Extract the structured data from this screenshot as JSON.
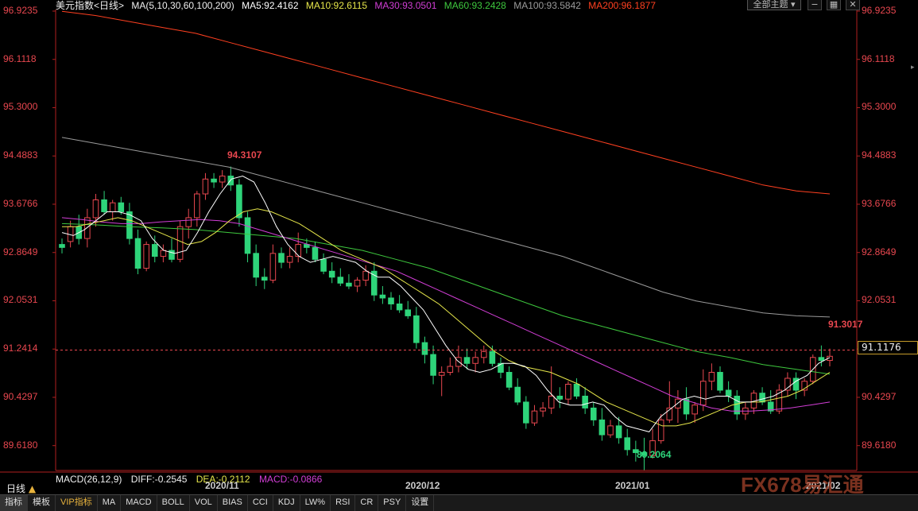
{
  "header": {
    "symbol": "美元指数<日线>",
    "ma_params": "MA(5,10,30,60,100,200)",
    "ma5": "MA5:92.4162",
    "ma10": "MA10:92.6115",
    "ma30": "MA30:93.0501",
    "ma60": "MA60:93.2428",
    "ma100": "MA100:93.5842",
    "ma200": "MA200:96.1877",
    "theme_button": "全部主题"
  },
  "colors": {
    "up": "#e8474f",
    "down": "#2ed47a",
    "ma5": "#ffffff",
    "ma10": "#e6e64a",
    "ma30": "#d23ed6",
    "ma60": "#3ec83e",
    "ma100": "#9a9a9a",
    "ma200": "#ff4020"
  },
  "annotations": {
    "high": "94.3107",
    "low": "89.2064",
    "last_high": "91.3017",
    "current_price": "91.1176"
  },
  "macd": {
    "params": "MACD(26,12,9)",
    "diff": "DIFF:-0.2545",
    "dea": "DEA:-0.2112",
    "macd": "MACD:-0.0866"
  },
  "period_tag": "日线",
  "date_labels": [
    "2020/11",
    "2020/12",
    "2021/01",
    "2021/02"
  ],
  "bottom_tabs": [
    "指标",
    "模板",
    "VIP指标",
    "MA",
    "MACD",
    "BOLL",
    "VOL",
    "BIAS",
    "CCI",
    "KDJ",
    "LW%",
    "RSI",
    "CR",
    "PSY",
    "设置"
  ],
  "watermark": "FX678易汇通",
  "chart_data": {
    "type": "candlestick",
    "y_ticks": [
      "96.9235",
      "96.1118",
      "95.3000",
      "94.4883",
      "93.6766",
      "92.8649",
      "92.0531",
      "91.2414",
      "90.4297",
      "89.6180"
    ],
    "ylim": [
      89.2,
      96.95
    ],
    "candles": [
      [
        93.0,
        93.1,
        92.85,
        92.95
      ],
      [
        93.05,
        93.4,
        92.95,
        93.3
      ],
      [
        93.3,
        93.5,
        93.0,
        93.1
      ],
      [
        93.1,
        93.6,
        92.95,
        93.45
      ],
      [
        93.45,
        93.85,
        93.3,
        93.75
      ],
      [
        93.75,
        93.9,
        93.5,
        93.55
      ],
      [
        93.55,
        93.75,
        93.4,
        93.7
      ],
      [
        93.7,
        93.8,
        93.5,
        93.55
      ],
      [
        93.55,
        93.7,
        93.0,
        93.1
      ],
      [
        93.1,
        93.25,
        92.5,
        92.6
      ],
      [
        92.6,
        93.05,
        92.55,
        93.0
      ],
      [
        93.0,
        93.15,
        92.7,
        92.8
      ],
      [
        92.8,
        93.0,
        92.7,
        92.9
      ],
      [
        92.9,
        93.1,
        92.7,
        92.75
      ],
      [
        92.75,
        93.4,
        92.7,
        93.3
      ],
      [
        93.3,
        93.6,
        93.1,
        93.45
      ],
      [
        93.45,
        93.9,
        93.3,
        93.85
      ],
      [
        93.85,
        94.2,
        93.75,
        94.1
      ],
      [
        94.1,
        94.2,
        93.95,
        94.05
      ],
      [
        94.05,
        94.25,
        93.95,
        94.15
      ],
      [
        94.15,
        94.3107,
        93.9,
        94.0
      ],
      [
        94.0,
        94.1,
        93.3,
        93.45
      ],
      [
        93.45,
        93.55,
        92.7,
        92.85
      ],
      [
        92.85,
        93.0,
        92.3,
        92.45
      ],
      [
        92.45,
        92.6,
        92.25,
        92.4
      ],
      [
        92.4,
        93.0,
        92.35,
        92.85
      ],
      [
        92.85,
        92.95,
        92.6,
        92.7
      ],
      [
        92.7,
        92.95,
        92.6,
        92.8
      ],
      [
        92.8,
        93.2,
        92.7,
        93.0
      ],
      [
        93.0,
        93.1,
        92.85,
        92.95
      ],
      [
        92.95,
        93.05,
        92.7,
        92.75
      ],
      [
        92.75,
        92.85,
        92.5,
        92.55
      ],
      [
        92.55,
        92.7,
        92.35,
        92.45
      ],
      [
        92.45,
        92.6,
        92.3,
        92.35
      ],
      [
        92.35,
        92.5,
        92.25,
        92.3
      ],
      [
        92.3,
        92.45,
        92.2,
        92.4
      ],
      [
        92.4,
        92.65,
        92.3,
        92.55
      ],
      [
        92.55,
        92.7,
        92.05,
        92.15
      ],
      [
        92.15,
        92.3,
        92.0,
        92.1
      ],
      [
        92.1,
        92.2,
        91.9,
        92.0
      ],
      [
        92.0,
        92.15,
        91.85,
        91.9
      ],
      [
        91.9,
        92.05,
        91.75,
        91.8
      ],
      [
        91.8,
        91.95,
        91.25,
        91.35
      ],
      [
        91.35,
        91.45,
        91.0,
        91.15
      ],
      [
        91.15,
        91.3,
        90.65,
        90.8
      ],
      [
        90.8,
        90.95,
        90.45,
        90.85
      ],
      [
        90.85,
        91.1,
        90.8,
        90.95
      ],
      [
        90.95,
        91.3,
        90.85,
        91.1
      ],
      [
        91.1,
        91.25,
        90.9,
        91.0
      ],
      [
        91.0,
        91.2,
        90.85,
        91.1
      ],
      [
        91.1,
        91.3,
        91.0,
        91.2
      ],
      [
        91.2,
        91.3,
        90.95,
        91.0
      ],
      [
        91.0,
        91.1,
        90.75,
        90.85
      ],
      [
        90.85,
        90.95,
        90.55,
        90.6
      ],
      [
        90.6,
        90.75,
        90.3,
        90.35
      ],
      [
        90.35,
        90.45,
        89.9,
        90.0
      ],
      [
        90.0,
        90.3,
        89.95,
        90.2
      ],
      [
        90.2,
        90.35,
        90.1,
        90.25
      ],
      [
        90.25,
        90.95,
        90.15,
        90.45
      ],
      [
        90.45,
        90.6,
        90.25,
        90.4
      ],
      [
        90.4,
        90.7,
        90.3,
        90.65
      ],
      [
        90.65,
        90.75,
        90.4,
        90.45
      ],
      [
        90.45,
        90.6,
        90.15,
        90.25
      ],
      [
        90.25,
        90.35,
        89.95,
        90.05
      ],
      [
        90.05,
        90.25,
        89.7,
        89.8
      ],
      [
        89.8,
        90.05,
        89.75,
        89.95
      ],
      [
        89.95,
        90.1,
        89.65,
        89.75
      ],
      [
        89.75,
        89.9,
        89.45,
        89.55
      ],
      [
        89.55,
        89.7,
        89.35,
        89.5
      ],
      [
        89.5,
        89.75,
        89.2064,
        89.45
      ],
      [
        89.45,
        89.9,
        89.4,
        89.7
      ],
      [
        89.7,
        90.15,
        89.65,
        90.05
      ],
      [
        90.05,
        90.7,
        90.0,
        90.25
      ],
      [
        90.25,
        90.55,
        90.0,
        90.4
      ],
      [
        90.4,
        90.6,
        90.05,
        90.15
      ],
      [
        90.15,
        90.35,
        90.0,
        90.3
      ],
      [
        90.3,
        90.9,
        90.2,
        90.7
      ],
      [
        90.7,
        91.0,
        90.55,
        90.85
      ],
      [
        90.85,
        90.95,
        90.5,
        90.55
      ],
      [
        90.55,
        90.7,
        90.35,
        90.45
      ],
      [
        90.45,
        90.55,
        90.05,
        90.15
      ],
      [
        90.15,
        90.35,
        90.05,
        90.25
      ],
      [
        90.25,
        90.55,
        90.15,
        90.5
      ],
      [
        90.5,
        90.6,
        90.3,
        90.35
      ],
      [
        90.35,
        90.55,
        90.15,
        90.2
      ],
      [
        90.2,
        90.65,
        90.15,
        90.55
      ],
      [
        90.55,
        90.85,
        90.45,
        90.75
      ],
      [
        90.75,
        90.85,
        90.4,
        90.55
      ],
      [
        90.55,
        90.75,
        90.45,
        90.7
      ],
      [
        90.7,
        91.15,
        90.65,
        91.1
      ],
      [
        91.1,
        91.3017,
        90.95,
        91.05
      ],
      [
        91.05,
        91.25,
        90.95,
        91.12
      ]
    ],
    "ma5": [
      93.2,
      93.15,
      93.25,
      93.4,
      93.55,
      93.55,
      93.5,
      93.4,
      93.1,
      92.9,
      92.85,
      92.9,
      93.2,
      93.55,
      93.85,
      94.1,
      94.15,
      94.05,
      93.7,
      93.3,
      93.0,
      92.8,
      92.7,
      92.75,
      92.8,
      92.75,
      92.7,
      92.55,
      92.45,
      92.45,
      92.3,
      92.1,
      91.9,
      91.6,
      91.3,
      91.05,
      90.9,
      90.85,
      90.9,
      91.0,
      91.0,
      90.95,
      90.8,
      90.55,
      90.35,
      90.3,
      90.3,
      90.35,
      90.3,
      90.1,
      89.95,
      89.9,
      89.85,
      90.1,
      90.25,
      90.4,
      90.45,
      90.4,
      90.45,
      90.45,
      90.35,
      90.35,
      90.4,
      90.45,
      90.55,
      90.7,
      90.8,
      91.0,
      91.1
    ],
    "ma10": [
      93.3,
      93.3,
      93.35,
      93.4,
      93.45,
      93.4,
      93.3,
      93.2,
      93.1,
      93.0,
      93.05,
      93.2,
      93.4,
      93.55,
      93.6,
      93.55,
      93.45,
      93.35,
      93.2,
      93.05,
      92.9,
      92.8,
      92.7,
      92.6,
      92.45,
      92.3,
      92.15,
      92.0,
      91.8,
      91.6,
      91.4,
      91.2,
      91.05,
      90.95,
      90.9,
      90.85,
      90.75,
      90.65,
      90.5,
      90.35,
      90.25,
      90.15,
      90.05,
      89.95,
      89.95,
      90.0,
      90.1,
      90.2,
      90.3,
      90.35,
      90.35,
      90.4,
      90.45,
      90.55,
      90.7,
      90.85
    ],
    "ma30": [
      93.45,
      93.42,
      93.38,
      93.35,
      93.35,
      93.38,
      93.4,
      93.42,
      93.4,
      93.35,
      93.25,
      93.15,
      93.05,
      92.95,
      92.85,
      92.75,
      92.65,
      92.55,
      92.4,
      92.25,
      92.1,
      91.95,
      91.8,
      91.65,
      91.5,
      91.35,
      91.2,
      91.05,
      90.9,
      90.75,
      90.6,
      90.45,
      90.35,
      90.25,
      90.2,
      90.2,
      90.22,
      90.25,
      90.3,
      90.35
    ],
    "ma60": [
      93.35,
      93.33,
      93.3,
      93.28,
      93.25,
      93.2,
      93.15,
      93.1,
      93.0,
      92.9,
      92.75,
      92.6,
      92.4,
      92.2,
      92.0,
      91.8,
      91.65,
      91.5,
      91.35,
      91.2,
      91.1,
      90.98,
      90.9,
      90.82
    ],
    "ma100": [
      94.8,
      94.7,
      94.6,
      94.5,
      94.4,
      94.3,
      94.15,
      94.0,
      93.85,
      93.7,
      93.55,
      93.4,
      93.25,
      93.1,
      92.95,
      92.8,
      92.6,
      92.4,
      92.2,
      92.05,
      91.95,
      91.85,
      91.8,
      91.78
    ],
    "ma200": [
      96.92,
      96.85,
      96.75,
      96.65,
      96.55,
      96.4,
      96.25,
      96.1,
      95.95,
      95.8,
      95.65,
      95.5,
      95.35,
      95.2,
      95.05,
      94.9,
      94.75,
      94.6,
      94.45,
      94.3,
      94.15,
      94.0,
      93.9,
      93.85
    ]
  }
}
